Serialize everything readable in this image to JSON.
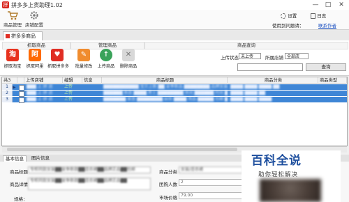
{
  "window": {
    "title": "拼多多上货助理1.02",
    "app_icon_glyph": "拼",
    "btn_min": "—",
    "btn_max": "□",
    "btn_close": "✕"
  },
  "toolbar": {
    "goods_manage": "商品管理",
    "store_config": "店铺配置",
    "settings": "设置",
    "log": "日志",
    "help_text": "使用到问题请：",
    "help_link": "联系作者"
  },
  "tabs": {
    "active": "拼多多商品"
  },
  "groups": {
    "fetch_title": "抓取商品",
    "manage_title": "管理商品",
    "query_title": "商品查询",
    "fetch_items": [
      {
        "label": "抓取淘宝",
        "glyph": "淘",
        "color": "#e8321e"
      },
      {
        "label": "抓取阿里",
        "glyph": "阿",
        "color": "#ff6a00"
      },
      {
        "label": "抓取拼多多",
        "glyph": "♥",
        "color": "#e02e24"
      }
    ],
    "manage_items": [
      {
        "label": "批量修改",
        "glyph": "✎",
        "color": "#f08c2e"
      },
      {
        "label": "上传商品",
        "glyph": "↑",
        "color": "#3aa35a"
      },
      {
        "label": "删除商品",
        "glyph": "✕",
        "color": "#c8c8c8"
      }
    ],
    "query": {
      "upload_status_label": "上传状态",
      "upload_status_value": "未上传",
      "store_label": "所属店铺",
      "store_value": "全部店",
      "search_value": "",
      "query_button": "查询"
    }
  },
  "grid": {
    "headers": [
      "共3",
      "",
      "上传店铺",
      "编辑",
      "信息",
      "商品标题",
      "商品分类",
      "商品类型"
    ],
    "rows": [
      {
        "no": "1",
        "store": "███ 上 拼 店",
        "edit": "上传",
        "info": "",
        "title": "███████████ 宝贝上新 ██ 夏季新品 ████████ 品牌女装 ████",
        "category": "████ ████ ████ ██"
      },
      {
        "no": "2",
        "store": "███ 上 拼 店",
        "edit": "上传",
        "info": "",
        "title": "██████ 新款 ████ 男士 ████████ 休闲 ██████ 时尚 ██████",
        "category": "████ ████ ██"
      },
      {
        "no": "3",
        "store": "███ 上 拼 店",
        "edit": "上传",
        "info": "",
        "title": "███████ 家居 ████████ 厨房 ████ 用品 █████ 包邮 ████",
        "category": "████ ████ ████"
      }
    ]
  },
  "detail": {
    "tabs": [
      "基本信息",
      "图片信息"
    ],
    "fields": {
      "title_label": "商品标题",
      "title_value": "专柜同款女装██夏季新款██连衣裙██品牌正品██包邮",
      "desc_label": "商品详情",
      "desc_value": "专柜同款女装██夏季新款██连衣裙██品牌正品██",
      "attr_label": "规格：",
      "category_label": "商品分类",
      "category_value": "女装/连衣裙",
      "group_label": "团购人数",
      "group_value": "2",
      "market_label": "市场价格",
      "market_value": "79.00"
    }
  },
  "watermark": {
    "title": "百科全说",
    "subtitle": "助你轻松解决"
  }
}
